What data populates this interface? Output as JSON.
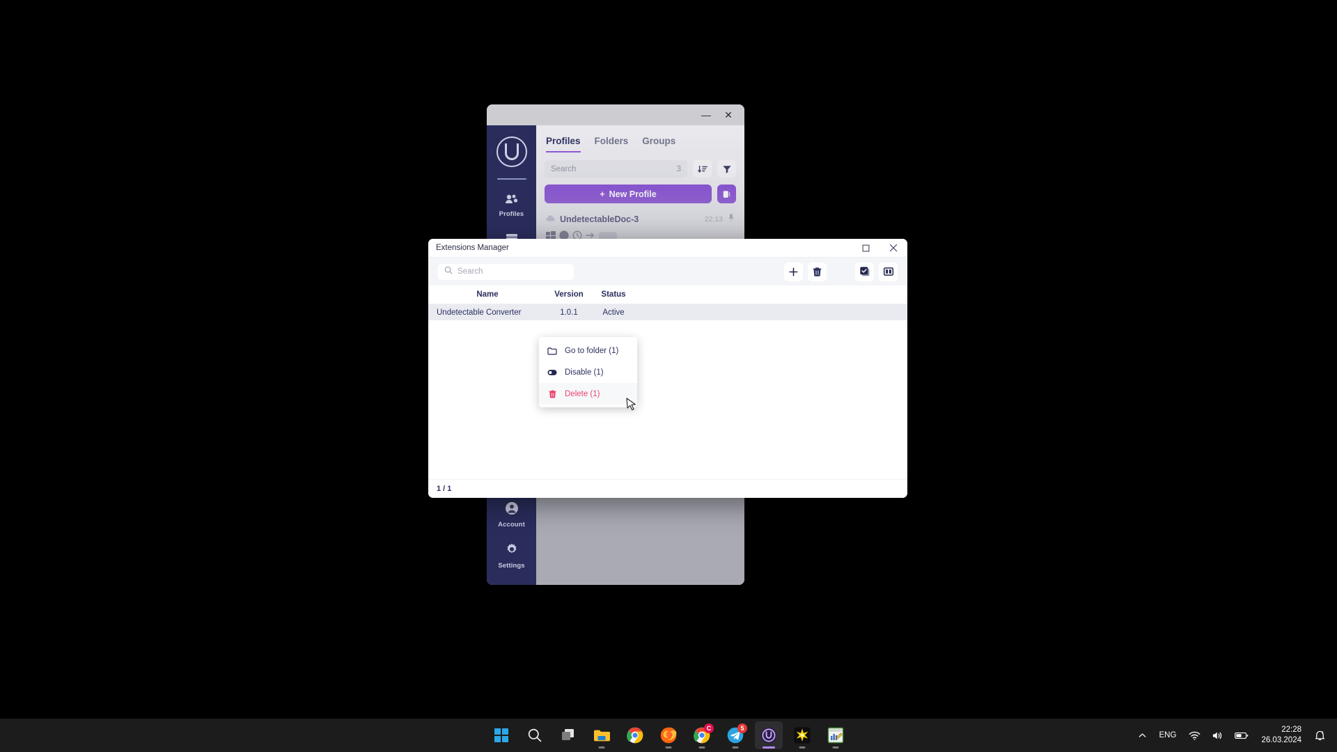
{
  "background_app": {
    "window_controls": {
      "minimize": "—",
      "close": "✕"
    },
    "sidebar": {
      "logo_name": "undetectable-logo",
      "items": [
        {
          "label": "Profiles",
          "icon": "profiles-icon"
        },
        {
          "label": "",
          "icon": "server-icon"
        },
        {
          "label": "Account",
          "icon": "account-icon"
        },
        {
          "label": "Settings",
          "icon": "settings-gear-icon"
        }
      ]
    },
    "tabs": [
      {
        "label": "Profiles",
        "active": true
      },
      {
        "label": "Folders",
        "active": false
      },
      {
        "label": "Groups",
        "active": false
      }
    ],
    "search": {
      "placeholder": "Search",
      "count": "3"
    },
    "sort_icon": "sort-descending-icon",
    "filter_icon": "filter-icon",
    "new_profile_label": "New Profile",
    "new_profile_plus": "+",
    "side_panel_icon": "side-panel-icon",
    "profiles": [
      {
        "name": "UndetectableDoc-3",
        "time": "22:13",
        "pin_icon": "pin-icon",
        "cloud_icon": "cloud-icon"
      }
    ]
  },
  "dialog": {
    "title": "Extensions Manager",
    "controls": {
      "maximize": "□",
      "close": "✕"
    },
    "search": {
      "value": "",
      "placeholder": "Search"
    },
    "toolbar_buttons": [
      {
        "name": "add-extension-button",
        "icon": "plus-icon",
        "label": "+"
      },
      {
        "name": "delete-extension-button",
        "icon": "trash-icon",
        "label": ""
      },
      {
        "name": "select-all-button",
        "icon": "checkbox-checked-icon",
        "label": ""
      },
      {
        "name": "toggle-columns-button",
        "icon": "columns-layout-icon",
        "label": ""
      }
    ],
    "table": {
      "columns": [
        "Name",
        "Version",
        "Status"
      ],
      "rows": [
        {
          "name": "Undetectable Converter",
          "version": "1.0.1",
          "status": "Active",
          "selected": true
        }
      ]
    },
    "footer": {
      "pagination": "1 / 1"
    }
  },
  "context_menu": {
    "items": [
      {
        "label": "Go to folder (1)",
        "icon": "folder-icon",
        "danger": false
      },
      {
        "label": "Disable (1)",
        "icon": "toggle-off-icon",
        "danger": false
      },
      {
        "label": "Delete (1)",
        "icon": "trash-icon",
        "danger": true
      }
    ]
  },
  "taskbar": {
    "items": [
      {
        "name": "start-button",
        "icon": "windows-start-icon",
        "badge": "",
        "running": false,
        "active": false
      },
      {
        "name": "search-button",
        "icon": "search-icon",
        "badge": "",
        "running": false,
        "active": false
      },
      {
        "name": "task-view-button",
        "icon": "task-view-icon",
        "badge": "",
        "running": false,
        "active": false
      },
      {
        "name": "file-explorer-button",
        "icon": "file-explorer-icon",
        "badge": "",
        "running": true,
        "active": false
      },
      {
        "name": "chrome-button",
        "icon": "chrome-icon",
        "badge": "",
        "running": false,
        "active": false
      },
      {
        "name": "firefox-button",
        "icon": "firefox-icon",
        "badge": "",
        "running": true,
        "active": false
      },
      {
        "name": "chrome-canary-button",
        "icon": "chrome-icon",
        "badge": "C",
        "running": true,
        "active": false
      },
      {
        "name": "telegram-button",
        "icon": "telegram-icon",
        "badge": "5",
        "running": true,
        "active": false
      },
      {
        "name": "undetectable-button",
        "icon": "undetectable-icon",
        "badge": "",
        "running": true,
        "active": true
      },
      {
        "name": "sparkle-app-button",
        "icon": "starburst-icon",
        "badge": "",
        "running": true,
        "active": false
      },
      {
        "name": "editor-app-button",
        "icon": "chart-editor-icon",
        "badge": "",
        "running": true,
        "active": false
      }
    ],
    "tray": {
      "overflow_icon": "chevron-up-icon",
      "language": "ENG",
      "wifi_icon": "wifi-icon",
      "volume_icon": "volume-icon",
      "battery_icon": "battery-icon",
      "time": "22:28",
      "date": "26.03.2024",
      "notification_icon": "bell-dnd-icon"
    }
  },
  "colors": {
    "accent_purple": "#7d3fd0",
    "sidebar_navy": "#2a2d5c",
    "danger_red": "#e8436c",
    "row_selected": "#e9ebf1"
  }
}
